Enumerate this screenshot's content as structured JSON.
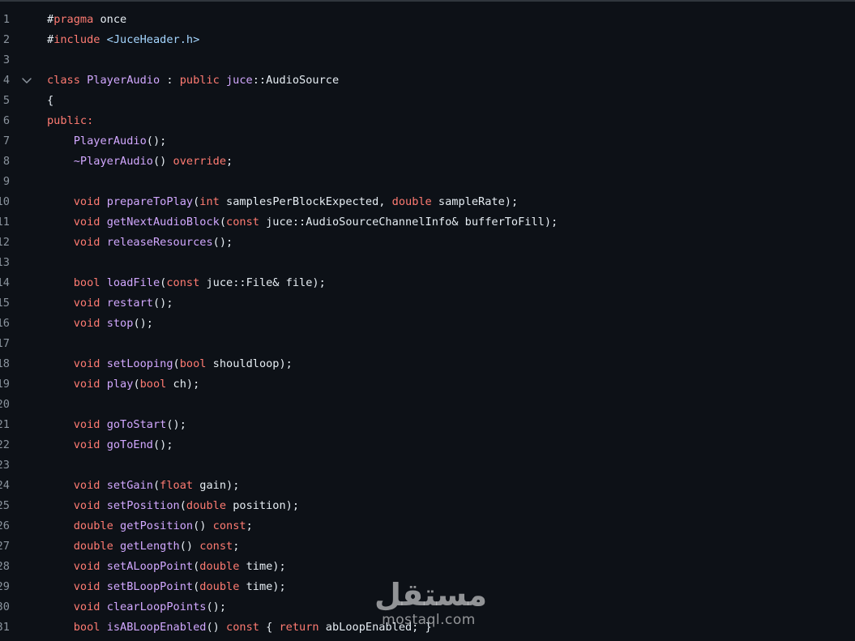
{
  "editor": {
    "lines": [
      {
        "n": "1",
        "tokens": [
          {
            "t": "#",
            "c": "plain"
          },
          {
            "t": "pragma",
            "c": "pre"
          },
          {
            "t": " once",
            "c": "plain"
          }
        ]
      },
      {
        "n": "2",
        "tokens": [
          {
            "t": "#",
            "c": "plain"
          },
          {
            "t": "include",
            "c": "pre"
          },
          {
            "t": " ",
            "c": "plain"
          },
          {
            "t": "<JuceHeader.h>",
            "c": "str"
          }
        ]
      },
      {
        "n": "3",
        "tokens": []
      },
      {
        "n": "4",
        "fold": true,
        "tokens": [
          {
            "t": "class",
            "c": "kw"
          },
          {
            "t": " ",
            "c": "plain"
          },
          {
            "t": "PlayerAudio",
            "c": "fn"
          },
          {
            "t": " : ",
            "c": "plain"
          },
          {
            "t": "public",
            "c": "kw"
          },
          {
            "t": " ",
            "c": "plain"
          },
          {
            "t": "juce",
            "c": "fn"
          },
          {
            "t": "::AudioSource",
            "c": "plain"
          }
        ]
      },
      {
        "n": "5",
        "tokens": [
          {
            "t": "{",
            "c": "plain"
          }
        ]
      },
      {
        "n": "6",
        "tokens": [
          {
            "t": "public:",
            "c": "kw"
          }
        ]
      },
      {
        "n": "7",
        "tokens": [
          {
            "t": "    ",
            "c": "plain"
          },
          {
            "t": "PlayerAudio",
            "c": "fn"
          },
          {
            "t": "();",
            "c": "plain"
          }
        ]
      },
      {
        "n": "8",
        "tokens": [
          {
            "t": "    ",
            "c": "plain"
          },
          {
            "t": "~PlayerAudio",
            "c": "fn"
          },
          {
            "t": "() ",
            "c": "plain"
          },
          {
            "t": "override",
            "c": "kw"
          },
          {
            "t": ";",
            "c": "plain"
          }
        ]
      },
      {
        "n": "9",
        "tokens": []
      },
      {
        "n": "10",
        "tokens": [
          {
            "t": "    ",
            "c": "plain"
          },
          {
            "t": "void",
            "c": "kw"
          },
          {
            "t": " ",
            "c": "plain"
          },
          {
            "t": "prepareToPlay",
            "c": "fn"
          },
          {
            "t": "(",
            "c": "plain"
          },
          {
            "t": "int",
            "c": "kw"
          },
          {
            "t": " samplesPerBlockExpected, ",
            "c": "plain"
          },
          {
            "t": "double",
            "c": "kw"
          },
          {
            "t": " sampleRate);",
            "c": "plain"
          }
        ]
      },
      {
        "n": "11",
        "tokens": [
          {
            "t": "    ",
            "c": "plain"
          },
          {
            "t": "void",
            "c": "kw"
          },
          {
            "t": " ",
            "c": "plain"
          },
          {
            "t": "getNextAudioBlock",
            "c": "fn"
          },
          {
            "t": "(",
            "c": "plain"
          },
          {
            "t": "const",
            "c": "kw"
          },
          {
            "t": " juce::AudioSourceChannelInfo& bufferToFill);",
            "c": "plain"
          }
        ]
      },
      {
        "n": "12",
        "tokens": [
          {
            "t": "    ",
            "c": "plain"
          },
          {
            "t": "void",
            "c": "kw"
          },
          {
            "t": " ",
            "c": "plain"
          },
          {
            "t": "releaseResources",
            "c": "fn"
          },
          {
            "t": "();",
            "c": "plain"
          }
        ]
      },
      {
        "n": "13",
        "tokens": []
      },
      {
        "n": "14",
        "tokens": [
          {
            "t": "    ",
            "c": "plain"
          },
          {
            "t": "bool",
            "c": "kw"
          },
          {
            "t": " ",
            "c": "plain"
          },
          {
            "t": "loadFile",
            "c": "fn"
          },
          {
            "t": "(",
            "c": "plain"
          },
          {
            "t": "const",
            "c": "kw"
          },
          {
            "t": " juce::File& file);",
            "c": "plain"
          }
        ]
      },
      {
        "n": "15",
        "tokens": [
          {
            "t": "    ",
            "c": "plain"
          },
          {
            "t": "void",
            "c": "kw"
          },
          {
            "t": " ",
            "c": "plain"
          },
          {
            "t": "restart",
            "c": "fn"
          },
          {
            "t": "();",
            "c": "plain"
          }
        ]
      },
      {
        "n": "16",
        "tokens": [
          {
            "t": "    ",
            "c": "plain"
          },
          {
            "t": "void",
            "c": "kw"
          },
          {
            "t": " ",
            "c": "plain"
          },
          {
            "t": "stop",
            "c": "fn"
          },
          {
            "t": "();",
            "c": "plain"
          }
        ]
      },
      {
        "n": "17",
        "tokens": []
      },
      {
        "n": "18",
        "tokens": [
          {
            "t": "    ",
            "c": "plain"
          },
          {
            "t": "void",
            "c": "kw"
          },
          {
            "t": " ",
            "c": "plain"
          },
          {
            "t": "setLooping",
            "c": "fn"
          },
          {
            "t": "(",
            "c": "plain"
          },
          {
            "t": "bool",
            "c": "kw"
          },
          {
            "t": " shouldloop);",
            "c": "plain"
          }
        ]
      },
      {
        "n": "19",
        "tokens": [
          {
            "t": "    ",
            "c": "plain"
          },
          {
            "t": "void",
            "c": "kw"
          },
          {
            "t": " ",
            "c": "plain"
          },
          {
            "t": "play",
            "c": "fn"
          },
          {
            "t": "(",
            "c": "plain"
          },
          {
            "t": "bool",
            "c": "kw"
          },
          {
            "t": " ch);",
            "c": "plain"
          }
        ]
      },
      {
        "n": "20",
        "tokens": []
      },
      {
        "n": "21",
        "tokens": [
          {
            "t": "    ",
            "c": "plain"
          },
          {
            "t": "void",
            "c": "kw"
          },
          {
            "t": " ",
            "c": "plain"
          },
          {
            "t": "goToStart",
            "c": "fn"
          },
          {
            "t": "();",
            "c": "plain"
          }
        ]
      },
      {
        "n": "22",
        "tokens": [
          {
            "t": "    ",
            "c": "plain"
          },
          {
            "t": "void",
            "c": "kw"
          },
          {
            "t": " ",
            "c": "plain"
          },
          {
            "t": "goToEnd",
            "c": "fn"
          },
          {
            "t": "();",
            "c": "plain"
          }
        ]
      },
      {
        "n": "23",
        "tokens": []
      },
      {
        "n": "24",
        "tokens": [
          {
            "t": "    ",
            "c": "plain"
          },
          {
            "t": "void",
            "c": "kw"
          },
          {
            "t": " ",
            "c": "plain"
          },
          {
            "t": "setGain",
            "c": "fn"
          },
          {
            "t": "(",
            "c": "plain"
          },
          {
            "t": "float",
            "c": "kw"
          },
          {
            "t": " gain);",
            "c": "plain"
          }
        ]
      },
      {
        "n": "25",
        "tokens": [
          {
            "t": "    ",
            "c": "plain"
          },
          {
            "t": "void",
            "c": "kw"
          },
          {
            "t": " ",
            "c": "plain"
          },
          {
            "t": "setPosition",
            "c": "fn"
          },
          {
            "t": "(",
            "c": "plain"
          },
          {
            "t": "double",
            "c": "kw"
          },
          {
            "t": " position);",
            "c": "plain"
          }
        ]
      },
      {
        "n": "26",
        "tokens": [
          {
            "t": "    ",
            "c": "plain"
          },
          {
            "t": "double",
            "c": "kw"
          },
          {
            "t": " ",
            "c": "plain"
          },
          {
            "t": "getPosition",
            "c": "fn"
          },
          {
            "t": "() ",
            "c": "plain"
          },
          {
            "t": "const",
            "c": "kw"
          },
          {
            "t": ";",
            "c": "plain"
          }
        ]
      },
      {
        "n": "27",
        "tokens": [
          {
            "t": "    ",
            "c": "plain"
          },
          {
            "t": "double",
            "c": "kw"
          },
          {
            "t": " ",
            "c": "plain"
          },
          {
            "t": "getLength",
            "c": "fn"
          },
          {
            "t": "() ",
            "c": "plain"
          },
          {
            "t": "const",
            "c": "kw"
          },
          {
            "t": ";",
            "c": "plain"
          }
        ]
      },
      {
        "n": "28",
        "tokens": [
          {
            "t": "    ",
            "c": "plain"
          },
          {
            "t": "void",
            "c": "kw"
          },
          {
            "t": " ",
            "c": "plain"
          },
          {
            "t": "setALoopPoint",
            "c": "fn"
          },
          {
            "t": "(",
            "c": "plain"
          },
          {
            "t": "double",
            "c": "kw"
          },
          {
            "t": " time);",
            "c": "plain"
          }
        ]
      },
      {
        "n": "29",
        "tokens": [
          {
            "t": "    ",
            "c": "plain"
          },
          {
            "t": "void",
            "c": "kw"
          },
          {
            "t": " ",
            "c": "plain"
          },
          {
            "t": "setBLoopPoint",
            "c": "fn"
          },
          {
            "t": "(",
            "c": "plain"
          },
          {
            "t": "double",
            "c": "kw"
          },
          {
            "t": " time);",
            "c": "plain"
          }
        ]
      },
      {
        "n": "30",
        "tokens": [
          {
            "t": "    ",
            "c": "plain"
          },
          {
            "t": "void",
            "c": "kw"
          },
          {
            "t": " ",
            "c": "plain"
          },
          {
            "t": "clearLoopPoints",
            "c": "fn"
          },
          {
            "t": "();",
            "c": "plain"
          }
        ]
      },
      {
        "n": "31",
        "tokens": [
          {
            "t": "    ",
            "c": "plain"
          },
          {
            "t": "bool",
            "c": "kw"
          },
          {
            "t": " ",
            "c": "plain"
          },
          {
            "t": "isABLoopEnabled",
            "c": "fn"
          },
          {
            "t": "() ",
            "c": "plain"
          },
          {
            "t": "const",
            "c": "kw"
          },
          {
            "t": " { ",
            "c": "plain"
          },
          {
            "t": "return",
            "c": "kw"
          },
          {
            "t": " abLoopEnabled; }",
            "c": "plain"
          }
        ]
      }
    ]
  },
  "watermark": {
    "arabic": "مستقل",
    "latin": "mostaql.com"
  },
  "colors": {
    "background": "#0d1117",
    "keyword": "#ff7b72",
    "function": "#d2a8ff",
    "string": "#a5d6ff",
    "text": "#e6edf3",
    "line_number": "#8b949e"
  },
  "icons": {
    "fold": "chevron-down-icon"
  }
}
